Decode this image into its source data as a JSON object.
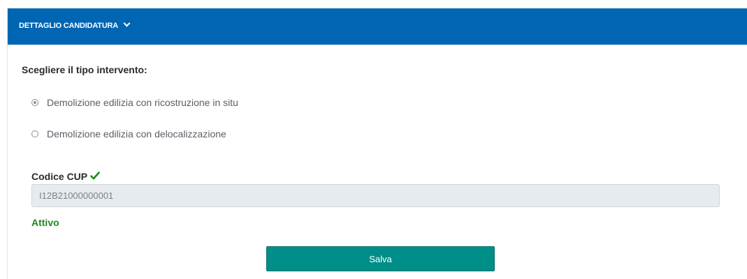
{
  "header": {
    "title": "DETTAGLIO CANDIDATURA",
    "toggle_icon": "chevron-down-icon",
    "background_color": "#0066b3"
  },
  "intervention": {
    "label": "Scegliere il tipo intervento:",
    "options": [
      {
        "label": "Demolizione edilizia con ricostruzione in situ",
        "selected": true
      },
      {
        "label": "Demolizione edilizia con delocalizzazione",
        "selected": false
      }
    ]
  },
  "cup": {
    "label": "Codice CUP",
    "verified_icon": "check-icon",
    "value": "I12B21000000001",
    "status": "Attivo",
    "status_color": "#1b8a1b"
  },
  "actions": {
    "save_label": "Salva",
    "save_color": "#008f88"
  }
}
